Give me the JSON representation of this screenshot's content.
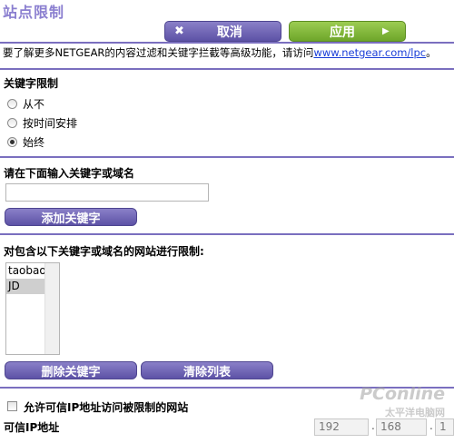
{
  "page": {
    "title": "站点限制"
  },
  "header": {
    "cancel_label": "取消",
    "apply_label": "应用"
  },
  "info": {
    "text": "要了解更多NETGEAR的内容过滤和关键字拦截等高级功能，请访问",
    "link": "www.netgear.com/lpc",
    "suffix": "。"
  },
  "keyword_block": {
    "heading": "关键字限制",
    "options": [
      "从不",
      "按时间安排",
      "始终"
    ],
    "selected": "始终"
  },
  "keyword_entry": {
    "heading": "请在下面输入关键字或域名",
    "value": "",
    "add_label": "添加关键字"
  },
  "blocked_list": {
    "heading": "对包含以下关键字或域名的网站进行限制:",
    "items": [
      "taobao",
      "JD"
    ],
    "selected": "JD",
    "delete_label": "删除关键字",
    "clear_label": "清除列表"
  },
  "trusted": {
    "checkbox_label": "允许可信IP地址访问被限制的网站",
    "checked": false,
    "ip_label": "可信IP地址",
    "ip_octets": [
      "192",
      "168",
      "1"
    ]
  },
  "watermark": {
    "brand": "PConline",
    "sub": "太平洋电脑网"
  }
}
